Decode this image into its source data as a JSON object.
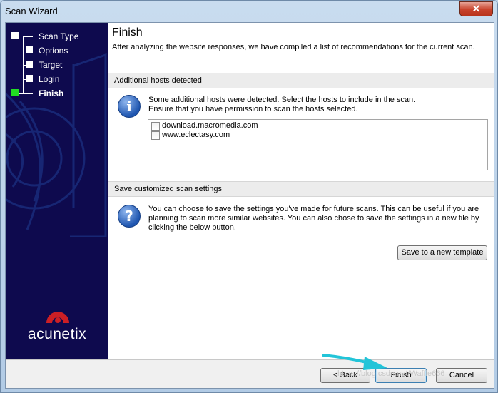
{
  "window": {
    "title": "Scan Wizard",
    "close_glyph": "✕"
  },
  "steps": [
    {
      "label": "Scan Type",
      "state": "done"
    },
    {
      "label": "Options",
      "state": "done"
    },
    {
      "label": "Target",
      "state": "done"
    },
    {
      "label": "Login",
      "state": "done"
    },
    {
      "label": "Finish",
      "state": "current"
    }
  ],
  "branding": {
    "logo_text": "acunetix",
    "logo_color": "#cc1f25"
  },
  "header": {
    "title": "Finish",
    "description": "After analyzing the website responses, we have compiled a list of recommendations for the current scan."
  },
  "hosts_section": {
    "heading": "Additional hosts detected",
    "icon": "info-icon",
    "message_line1": "Some additional hosts were detected. Select the hosts to include in the scan.",
    "message_line2": "Ensure that you have permission to scan the hosts selected.",
    "hosts": [
      {
        "name": "download.macromedia.com",
        "checked": false
      },
      {
        "name": "www.eclectasy.com",
        "checked": false
      }
    ]
  },
  "save_section": {
    "heading": "Save customized scan settings",
    "icon": "help-icon",
    "message_line1": "You can choose to save the settings you've made for future scans. This can be useful if you are",
    "message_line2": "planning to scan more similar websites. You can also chose to save the settings in a new file by",
    "message_line3": "clicking the below button.",
    "button_label": "Save to a new template"
  },
  "footer": {
    "back_label": "< Back",
    "finish_label": "Finish",
    "cancel_label": "Cancel",
    "watermark": "https://blog.csdn.net/Waffle666"
  },
  "colors": {
    "sidebar": "#0e0a4e",
    "current_step": "#22dd22",
    "arrow": "#22c4d8"
  }
}
